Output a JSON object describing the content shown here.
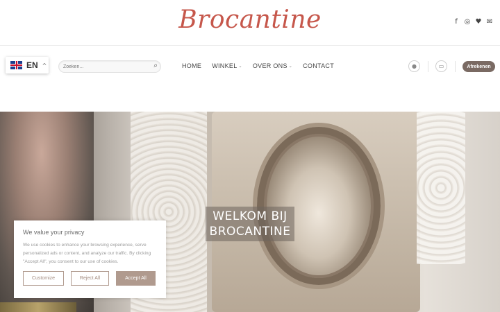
{
  "header": {
    "logo_text": "Brocantine",
    "social": [
      {
        "icon": "facebook-icon",
        "glyph": "f"
      },
      {
        "icon": "instagram-icon",
        "glyph": "◎"
      },
      {
        "icon": "twitter-icon",
        "glyph": "♥"
      },
      {
        "icon": "email-icon",
        "glyph": "✉"
      }
    ]
  },
  "nav": {
    "language": {
      "code": "EN",
      "caret": "^"
    },
    "search": {
      "placeholder": "Zoeken...",
      "icon": "⌕"
    },
    "menu": [
      {
        "label": "HOME",
        "has_dropdown": false
      },
      {
        "label": "WINKEL",
        "has_dropdown": true
      },
      {
        "label": "OVER ONS",
        "has_dropdown": true
      },
      {
        "label": "CONTACT",
        "has_dropdown": false
      }
    ],
    "dropdown_glyph": "⌄",
    "account_glyph": "👤",
    "cart_glyph": "🛒",
    "checkout_label": "Afrekenen"
  },
  "hero": {
    "line1": "WELKOM BIJ",
    "line2": "BROCANTINE"
  },
  "cookie": {
    "title": "We value your privacy",
    "text": "We use cookies to enhance your browsing experience, serve personalized ads or content, and analyze our traffic. By clicking \"Accept All\", you consent to our use of cookies.",
    "buttons": {
      "customize": "Customize",
      "reject": "Reject All",
      "accept": "Accept All"
    }
  },
  "colors": {
    "brand": "#c6574b",
    "checkout_bg": "#7a6a63",
    "cookie_accent": "#b09a8e"
  }
}
